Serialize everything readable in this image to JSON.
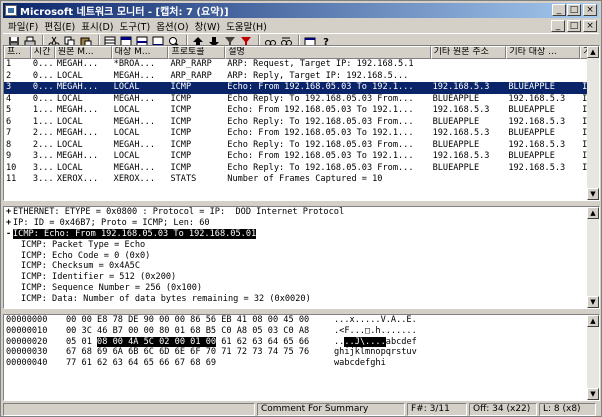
{
  "window": {
    "title": "Microsoft 네트워크 모니터 - [캡처: 7 (요약)]",
    "buttons": {
      "min": "_",
      "max": "□",
      "close": "×",
      "child_min": "_",
      "child_max": "□",
      "child_close": "×"
    }
  },
  "menu": [
    "파일(F)",
    "편집(E)",
    "표시(D)",
    "도구(T)",
    "옵션(O)",
    "창(W)",
    "도움말(H)"
  ],
  "toolbar": {
    "icons": [
      "save-icon",
      "print-icon",
      "cut-icon",
      "copy-icon",
      "paste-icon",
      "pane-layout-icon",
      "summary-view-icon",
      "detail-view-icon",
      "hex-view-icon",
      "zoom-icon",
      "find-icon",
      "up-arrow-icon",
      "down-arrow-icon",
      "filter-icon",
      "display-filter-icon",
      "find-next-icon",
      "find-prev-icon",
      "window-icon",
      "help-icon"
    ],
    "help_label": "?"
  },
  "summary": {
    "headers": [
      "프..",
      "시간",
      "원본 M...",
      "대상 M...",
      "프로토콜",
      "설명",
      "기타 원본 주소",
      "기타 대상 ...",
      "기"
    ],
    "rows": [
      [
        "1",
        "0...",
        "MEGAH...",
        "*BROA...",
        "ARP_RARP",
        "ARP: Request, Target IP: 192.168.5.1",
        "",
        "",
        ""
      ],
      [
        "2",
        "0...",
        "LOCAL",
        "MEGAH...",
        "ARP_RARP",
        "ARP: Reply, Target IP: 192.168.5...",
        "",
        "",
        ""
      ],
      [
        "3",
        "0...",
        "MEGAH...",
        "LOCAL",
        "ICMP",
        "Echo: From 192.168.05.03 To 192.1...",
        "192.168.5.3",
        "BLUEAPPLE",
        "I"
      ],
      [
        "4",
        "0...",
        "LOCAL",
        "MEGAH...",
        "ICMP",
        "Echo Reply: To 192.168.05.03 From...",
        "BLUEAPPLE",
        "192.168.5.3",
        "I"
      ],
      [
        "5",
        "1...",
        "MEGAH...",
        "LOCAL",
        "ICMP",
        "Echo: From 192.168.05.03 To 192.1...",
        "192.168.5.3",
        "BLUEAPPLE",
        "I"
      ],
      [
        "6",
        "1...",
        "LOCAL",
        "MEGAH...",
        "ICMP",
        "Echo Reply: To 192.168.05.03 From...",
        "BLUEAPPLE",
        "192.168.5.3",
        "I"
      ],
      [
        "7",
        "2...",
        "MEGAH...",
        "LOCAL",
        "ICMP",
        "Echo: From 192.168.05.03 To 192.1...",
        "192.168.5.3",
        "BLUEAPPLE",
        "I"
      ],
      [
        "8",
        "2...",
        "LOCAL",
        "MEGAH...",
        "ICMP",
        "Echo Reply: To 192.168.05.03 From...",
        "BLUEAPPLE",
        "192.168.5.3",
        "I"
      ],
      [
        "9",
        "3...",
        "MEGAH...",
        "LOCAL",
        "ICMP",
        "Echo: From 192.168.05.03 To 192.1...",
        "192.168.5.3",
        "BLUEAPPLE",
        "I"
      ],
      [
        "10",
        "3...",
        "LOCAL",
        "MEGAH...",
        "ICMP",
        "Echo Reply: To 192.168.05.03 From...",
        "BLUEAPPLE",
        "192.168.5.3",
        "I"
      ],
      [
        "11",
        "3...",
        "XEROX...",
        "XEROX...",
        "STATS",
        "Number of Frames Captured = 10",
        "",
        "",
        ""
      ]
    ],
    "selected_index": 2
  },
  "detail": {
    "lines": [
      {
        "node": "+",
        "text": "ETHERNET: ETYPE = 0x0800 : Protocol = IP:  DOD Internet Protocol",
        "indent": 0
      },
      {
        "node": "+",
        "text": "IP: ID = 0x46B7; Proto = ICMP; Len: 60",
        "indent": 0
      },
      {
        "node": "-",
        "text": "ICMP: Echo: From 192.168.05.03 To 192.168.05.01",
        "indent": 0,
        "selected": true
      },
      {
        "node": "",
        "text": "ICMP: Packet Type = Echo",
        "indent": 1
      },
      {
        "node": "",
        "text": "ICMP: Echo Code = 0 (0x0)",
        "indent": 1
      },
      {
        "node": "",
        "text": "ICMP: Checksum = 0x4A5C",
        "indent": 1
      },
      {
        "node": "",
        "text": "ICMP: Identifier = 512 (0x200)",
        "indent": 1
      },
      {
        "node": "",
        "text": "ICMP: Sequence Number = 256 (0x100)",
        "indent": 1
      },
      {
        "node": "",
        "text": "ICMP: Data: Number of data bytes remaining = 32 (0x0020)",
        "indent": 1
      }
    ]
  },
  "hex": {
    "lines": [
      {
        "offset": "00000000",
        "pre": "00 00 E8 78 DE 90 00 00 86 56 EB 41 08 00 45 00",
        "hl": "",
        "post": "",
        "ascii_pre": "...x.....V.A..E.",
        "ascii_hl": "",
        "ascii_post": ""
      },
      {
        "offset": "00000010",
        "pre": "00 3C 46 B7 00 00 80 01 68 B5 C0 A8 05 03 C0 A8",
        "hl": "",
        "post": "",
        "ascii_pre": ".<F...□.h.......",
        "ascii_hl": "",
        "ascii_post": ""
      },
      {
        "offset": "00000020",
        "pre": "05 01 ",
        "hl": "08 00 4A 5C 02 00 01 00",
        "post": " 61 62 63 64 65 66",
        "ascii_pre": "..",
        "ascii_hl": "..J\\....",
        "ascii_post": "abcdef"
      },
      {
        "offset": "00000030",
        "pre": "67 68 69 6A 6B 6C 6D 6E 6F 70 71 72 73 74 75 76",
        "hl": "",
        "post": "",
        "ascii_pre": "ghijklmnopqrstuv",
        "ascii_hl": "",
        "ascii_post": ""
      },
      {
        "offset": "00000040",
        "pre": "77 61 62 63 64 65 66 67 68 69",
        "hl": "",
        "post": "",
        "ascii_pre": "wabcdefghi",
        "ascii_hl": "",
        "ascii_post": ""
      }
    ]
  },
  "status": {
    "panel1": "",
    "panel2": "Comment For Summary",
    "frame": "F#: 3/11",
    "offset": "Off: 34 (x22)",
    "length": "L: 8 (x8)"
  }
}
